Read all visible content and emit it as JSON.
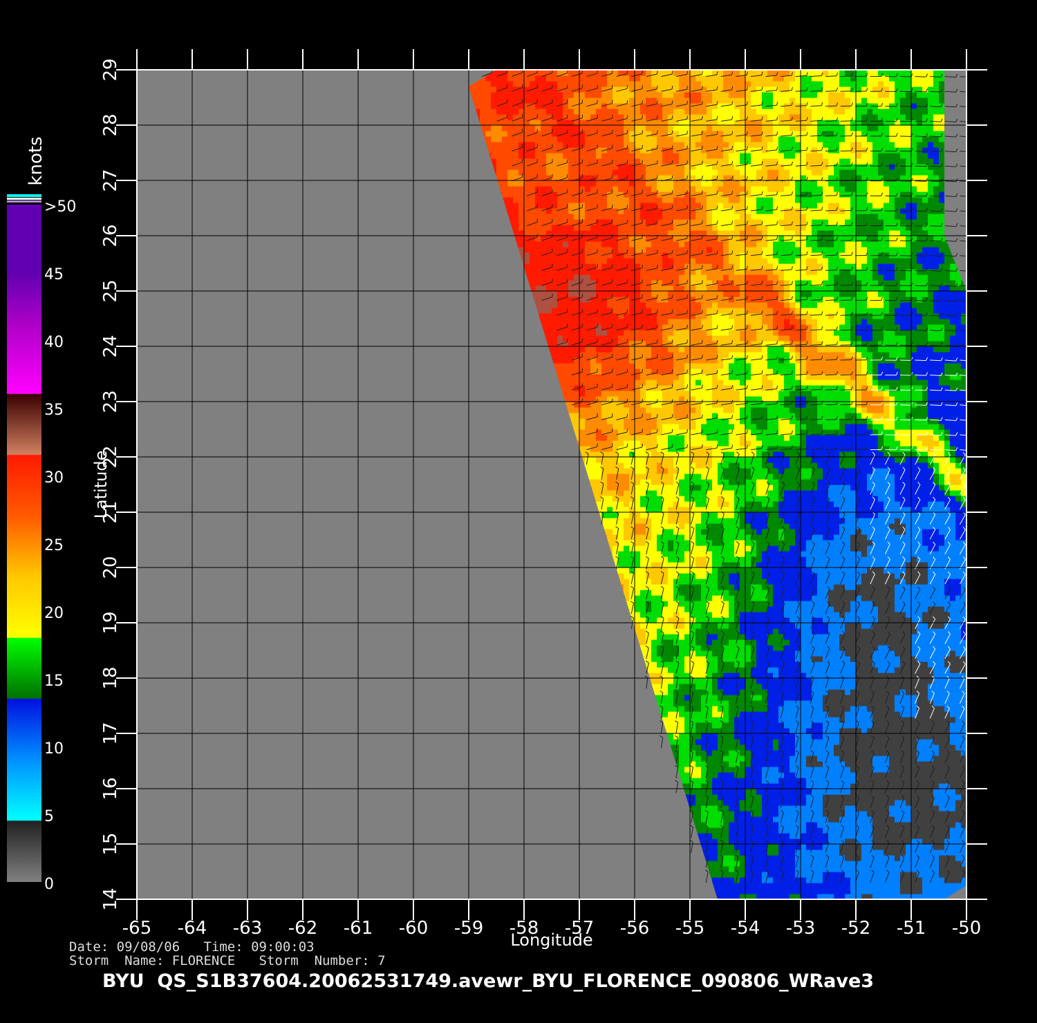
{
  "map": {
    "axes": {
      "x_label": "Longitude",
      "y_label": "Latitude",
      "lon_range": [
        -65,
        -50
      ],
      "lat_range": [
        14,
        29
      ],
      "lon_ticks": [
        "-65",
        "-64",
        "-63",
        "-62",
        "-61",
        "-60",
        "-59",
        "-58",
        "-57",
        "-56",
        "-55",
        "-54",
        "-53",
        "-52",
        "-51",
        "-50"
      ],
      "lat_ticks": [
        "14",
        "15",
        "16",
        "17",
        "18",
        "19",
        "20",
        "21",
        "22",
        "23",
        "24",
        "25",
        "26",
        "27",
        "28",
        "29"
      ],
      "grid": true
    },
    "colorbar": {
      "unit_label": "knots",
      "labels": [
        "0",
        "5",
        "10",
        "15",
        "20",
        "25",
        "30",
        "35",
        "40",
        "45",
        ">50"
      ],
      "colors": [
        "#808080",
        "#1a1a1a",
        "#00ffff",
        "#0050ff",
        "#0010e0",
        "#00e000",
        "#007800",
        "#ffff00",
        "#ffc800",
        "#ff8c00",
        "#e65000",
        "#ff1a00",
        "#c88060",
        "#3a0000",
        "#ff00ff",
        "#9000c8",
        "#6000b0"
      ]
    },
    "swath_edge": [
      [
        -59.0,
        28.7
      ],
      [
        -58.5,
        29.0
      ],
      [
        -54.3,
        14.0
      ],
      [
        -54.5,
        14.0
      ]
    ],
    "no_data_color": "#808080",
    "background_color": "#000000"
  },
  "info": {
    "date_time": "Date: 09/08/06   Time: 09:00:03",
    "storm": "Storm  Name: FLORENCE   Storm  Number: 7",
    "file_title": "BYU  QS_S1B37604.20062531749.avewr_BYU_FLORENCE_090806_WRave3"
  }
}
